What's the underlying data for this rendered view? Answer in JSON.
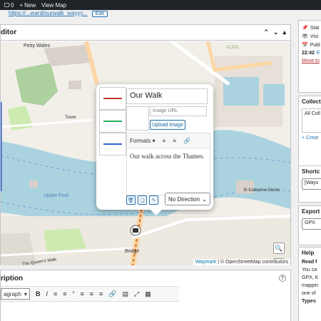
{
  "admin_bar": {
    "comments_count": "0",
    "new_label": "New",
    "view_map_label": "View Map"
  },
  "permalink": {
    "url_text": "https://...ward/ourwalk_wayyy...",
    "edit_label": "Edit"
  },
  "editor": {
    "title": "ditor",
    "map": {
      "attribution_waymark": "Waymark",
      "attribution_osm": "| © OpenStreetMap contributors",
      "labels": {
        "petty_wales": "Petty Wales",
        "tower_hill": "Tower Hill",
        "a1203": "A1203",
        "shadwell": "St Katharine Docks",
        "waters_edge": "Upper Pool",
        "bridge": "Bridge",
        "queens_walk": "The Queen's Walk",
        "tower": "Tower"
      }
    },
    "popup": {
      "title_value": "Our Walk",
      "image_url_placeholder": "Image URL",
      "upload_label": "Upload Image",
      "formats_label": "Formats",
      "description": "Our walk across the Thames.",
      "direction_label": "No Direction",
      "line_colors": [
        "#c0392b",
        "#27ae60",
        "#2e5fd0"
      ]
    }
  },
  "description_panel": {
    "title": "ription",
    "help_icon": "?",
    "paragraph_label": "agraph"
  },
  "sidebar": {
    "publish": {
      "status_label": "Stat",
      "visibility_label": "Visi",
      "published_label": "Publ",
      "published_time": "22:42",
      "edit_link": "E",
      "trash_label": "Move to"
    },
    "collections": {
      "title": "Collect",
      "all_label": "All Coll",
      "create_label": "+ Creat"
    },
    "shortcode": {
      "title": "Shortc",
      "value": "[Ways"
    },
    "export": {
      "title": "Export",
      "value": "GPX"
    },
    "help": {
      "title": "Help",
      "read_label": "Read f",
      "lines": [
        "You ca",
        "GPX, K",
        "mappin",
        "one of"
      ],
      "types_label": "Types"
    }
  }
}
